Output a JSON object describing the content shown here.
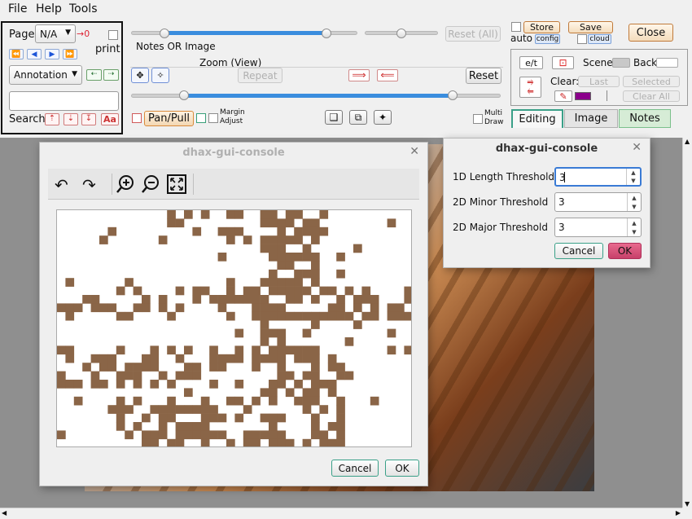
{
  "menu": {
    "file": "File",
    "help": "Help",
    "tools": "Tools"
  },
  "left_panel": {
    "page_label": "Page",
    "page_select": "N/A",
    "page_indicator": "→0",
    "print_label": "print",
    "annotation_select": "Annotation",
    "search_label": "Search",
    "font_button": "Aa",
    "search_value": ""
  },
  "sliders": {
    "top_slider_value": 0.56,
    "side_slider_value": 0.48,
    "zoom_low": 0.22,
    "zoom_high": 0.9
  },
  "labels": {
    "notes_or_image": "Notes OR Image",
    "zoom_view": "Zoom (View)",
    "reset_all": "Reset (All)",
    "repeat": "Repeat",
    "reset": "Reset",
    "pan_pull": "Pan/Pull",
    "margin": "Margin",
    "adjust": "Adjust",
    "multi": "Multi",
    "draw": "Draw"
  },
  "right_panel": {
    "store": "Store",
    "save": "Save",
    "close": "Close",
    "auto": "auto",
    "config": "config",
    "cloud": "cloud",
    "et": "e/t",
    "scene": "Scene",
    "back": "Back",
    "clear": "Clear:",
    "last": "Last",
    "selected": "Selected",
    "clear_all": "Clear All",
    "pen_color": "#8b008b"
  },
  "tabs": [
    {
      "label": "Editing"
    },
    {
      "label": "Image"
    },
    {
      "label": "Notes"
    }
  ],
  "dialog_image": {
    "title": "dhax-gui-console",
    "cancel": "Cancel",
    "ok": "OK",
    "cell_color": "#8a6547"
  },
  "dialog_threshold": {
    "title": "dhax-gui-console",
    "rows": [
      {
        "label": "1D Length Threshold",
        "value": "3"
      },
      {
        "label": "2D Minor Threshold",
        "value": "3"
      },
      {
        "label": "2D Major Threshold",
        "value": "3"
      }
    ],
    "cancel": "Cancel",
    "ok": "OK"
  }
}
